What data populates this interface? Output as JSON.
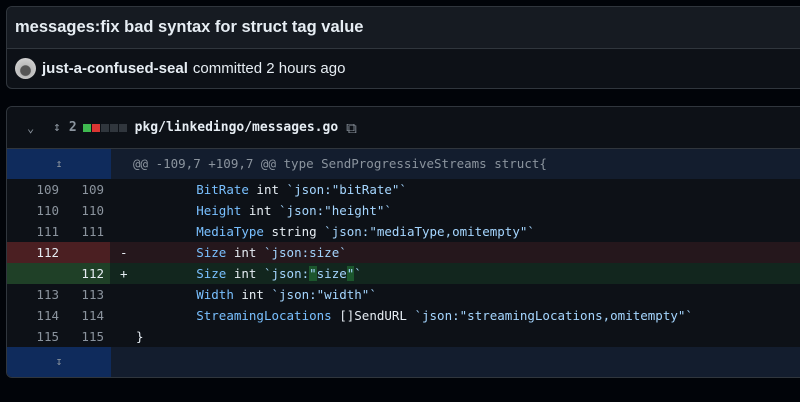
{
  "commit": {
    "title": "messages:fix bad syntax for struct tag value",
    "author": "just-a-confused-seal",
    "action": "committed",
    "time": "2 hours ago"
  },
  "file": {
    "changes": "2",
    "path": "pkg/linkedingo/messages.go",
    "diffstat": [
      "#3fb950",
      "#da3633",
      "#30363d",
      "#30363d",
      "#30363d"
    ],
    "icons": {
      "collapse": "chevron-down-icon",
      "expand": "unfold-icon",
      "copy": "copy-icon"
    }
  },
  "hunk": "@@ -109,7 +109,7 @@ type SendProgressiveStreams struct{",
  "lines": [
    {
      "type": "ctx",
      "old": "109",
      "new": "109",
      "mark": "",
      "tokens": [
        [
          "p",
          "        "
        ],
        [
          "f",
          "BitRate"
        ],
        [
          "p",
          " int "
        ],
        [
          "s",
          "`json:\"bitRate\"`"
        ]
      ]
    },
    {
      "type": "ctx",
      "old": "110",
      "new": "110",
      "mark": "",
      "tokens": [
        [
          "p",
          "        "
        ],
        [
          "f",
          "Height"
        ],
        [
          "p",
          " int "
        ],
        [
          "s",
          "`json:\"height\"`"
        ]
      ]
    },
    {
      "type": "ctx",
      "old": "111",
      "new": "111",
      "mark": "",
      "tokens": [
        [
          "p",
          "        "
        ],
        [
          "f",
          "MediaType"
        ],
        [
          "p",
          " string "
        ],
        [
          "s",
          "`json:\"mediaType,omitempty\"`"
        ]
      ]
    },
    {
      "type": "del",
      "old": "112",
      "new": "",
      "mark": "-",
      "tokens": [
        [
          "p",
          "        "
        ],
        [
          "f",
          "Size"
        ],
        [
          "p",
          " int "
        ],
        [
          "s",
          "`json:size`"
        ]
      ]
    },
    {
      "type": "add",
      "old": "",
      "new": "112",
      "mark": "+",
      "tokens": [
        [
          "p",
          "        "
        ],
        [
          "f",
          "Size"
        ],
        [
          "p",
          " int "
        ],
        [
          "s",
          "`json:"
        ],
        [
          "h",
          "\""
        ],
        [
          "s",
          "size"
        ],
        [
          "h",
          "\""
        ],
        [
          "s",
          "`"
        ]
      ]
    },
    {
      "type": "ctx",
      "old": "113",
      "new": "113",
      "mark": "",
      "tokens": [
        [
          "p",
          "        "
        ],
        [
          "f",
          "Width"
        ],
        [
          "p",
          " int "
        ],
        [
          "s",
          "`json:\"width\"`"
        ]
      ]
    },
    {
      "type": "ctx",
      "old": "114",
      "new": "114",
      "mark": "",
      "tokens": [
        [
          "p",
          "        "
        ],
        [
          "f",
          "StreamingLocations"
        ],
        [
          "p",
          " []SendURL "
        ],
        [
          "s",
          "`json:\"streamingLocations,omitempty\"`"
        ]
      ]
    },
    {
      "type": "ctx",
      "old": "115",
      "new": "115",
      "mark": "",
      "tokens": [
        [
          "p",
          "}"
        ]
      ]
    }
  ]
}
